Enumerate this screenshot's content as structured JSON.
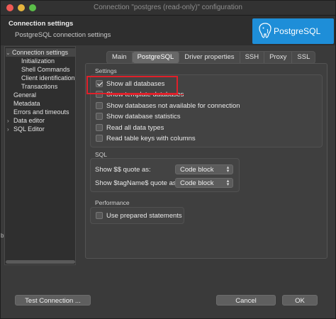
{
  "window": {
    "title": "Connection \"postgres (read-only)\" configuration"
  },
  "header": {
    "title": "Connection settings",
    "subtitle": "PostgreSQL connection settings",
    "logo_text": "PostgreSQL"
  },
  "tree": {
    "items": [
      {
        "label": "Connection settings",
        "arrow": "⌄"
      },
      {
        "label": "Initialization"
      },
      {
        "label": "Shell Commands"
      },
      {
        "label": "Client identification"
      },
      {
        "label": "Transactions"
      },
      {
        "label": "General"
      },
      {
        "label": "Metadata"
      },
      {
        "label": "Errors and timeouts"
      },
      {
        "label": "Data editor",
        "arrow": "›"
      },
      {
        "label": "SQL Editor",
        "arrow": "›"
      }
    ]
  },
  "tabs": [
    "Main",
    "PostgreSQL",
    "Driver properties",
    "SSH",
    "Proxy",
    "SSL"
  ],
  "settings": {
    "label": "Settings",
    "checkboxes": [
      {
        "label": "Show all databases",
        "checked": true
      },
      {
        "label": "Show template databases",
        "checked": false
      },
      {
        "label": "Show databases not available for connection",
        "checked": false
      },
      {
        "label": "Show database statistics",
        "checked": false
      },
      {
        "label": "Read all data types",
        "checked": false
      },
      {
        "label": "Read table keys with columns",
        "checked": false
      }
    ]
  },
  "sql": {
    "label": "SQL",
    "rows": [
      {
        "label": "Show $$ quote as:",
        "value": "Code block"
      },
      {
        "label": "Show $tagName$ quote as:",
        "value": "Code block"
      }
    ]
  },
  "performance": {
    "label": "Performance",
    "prepared_statements": {
      "label": "Use prepared statements",
      "checked": false
    }
  },
  "buttons": {
    "test": "Test Connection ...",
    "cancel": "Cancel",
    "ok": "OK"
  },
  "side_glyph": "b",
  "colors": {
    "logo_bg": "#1e8ed8",
    "highlight": "#e0202a"
  }
}
